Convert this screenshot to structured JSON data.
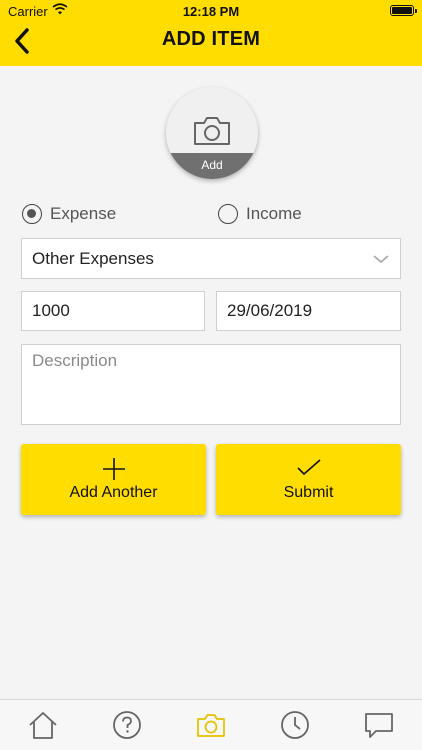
{
  "status_bar": {
    "carrier": "Carrier",
    "time": "12:18 PM"
  },
  "header": {
    "title": "ADD ITEM",
    "back_icon": "chevron-left-icon"
  },
  "photo": {
    "label": "Add",
    "icon": "camera-icon"
  },
  "type_options": [
    {
      "label": "Expense",
      "selected": true
    },
    {
      "label": "Income",
      "selected": false
    }
  ],
  "category": {
    "value": "Other Expenses"
  },
  "amount": {
    "value": "1000"
  },
  "date": {
    "value": "29/06/2019"
  },
  "description": {
    "placeholder": "Description",
    "value": ""
  },
  "buttons": {
    "add_another": "Add Another",
    "submit": "Submit"
  },
  "tab_bar": {
    "items": [
      "home-icon",
      "help-icon",
      "camera-icon",
      "history-icon",
      "chat-icon"
    ],
    "active": "camera-icon"
  },
  "colors": {
    "accent": "#FFDD00",
    "active_tab": "#E6C200",
    "icon": "#666666"
  }
}
